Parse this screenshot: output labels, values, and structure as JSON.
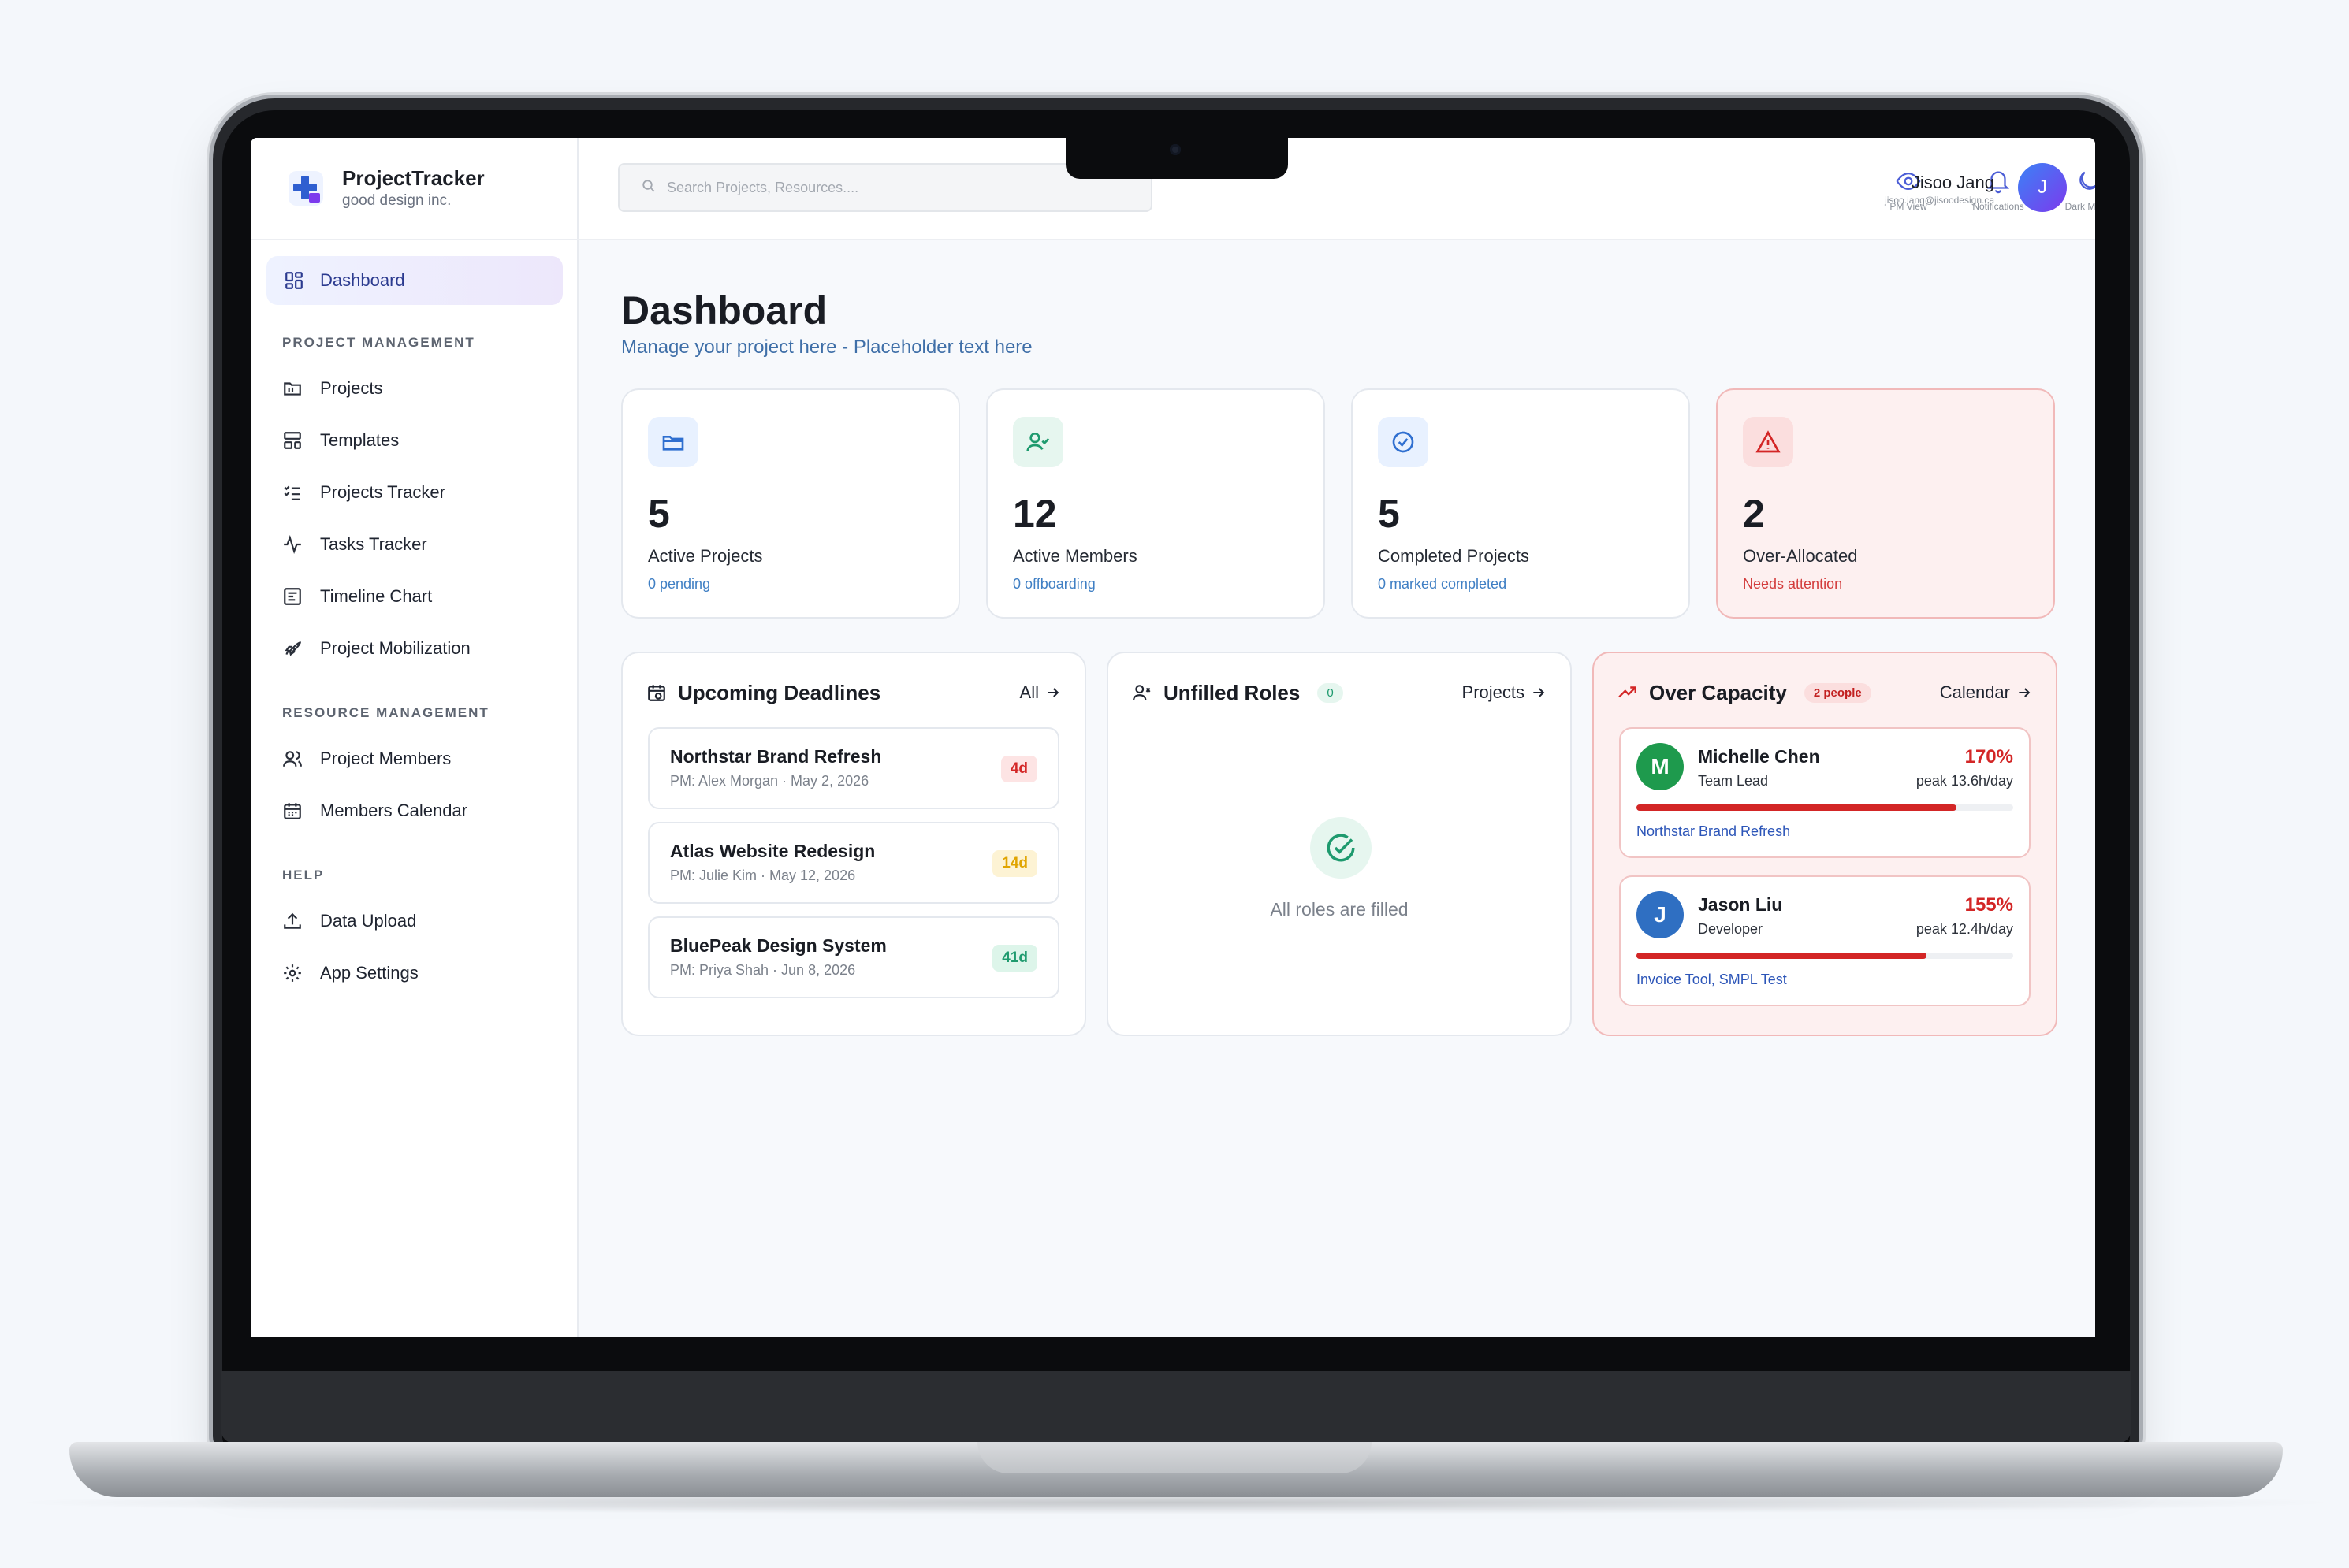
{
  "app": {
    "name": "ProjectTracker",
    "org": "good design inc."
  },
  "sidebar": {
    "active": {
      "label": "Dashboard",
      "icon": "dashboard-grid-icon"
    },
    "sections": [
      {
        "title": "PROJECT MANAGEMENT",
        "items": [
          {
            "label": "Projects",
            "icon": "folder-icon"
          },
          {
            "label": "Templates",
            "icon": "template-icon"
          },
          {
            "label": "Projects Tracker",
            "icon": "checklist-icon"
          },
          {
            "label": "Tasks Tracker",
            "icon": "activity-icon"
          },
          {
            "label": "Timeline Chart",
            "icon": "timeline-icon"
          },
          {
            "label": "Project Mobilization",
            "icon": "rocket-icon"
          }
        ]
      },
      {
        "title": "RESOURCE MANAGEMENT",
        "items": [
          {
            "label": "Project Members",
            "icon": "users-icon"
          },
          {
            "label": "Members Calendar",
            "icon": "calendar-icon"
          }
        ]
      },
      {
        "title": "HELP",
        "items": [
          {
            "label": "Data Upload",
            "icon": "upload-icon"
          },
          {
            "label": "App Settings",
            "icon": "gear-icon"
          }
        ]
      }
    ]
  },
  "topbar": {
    "search_placeholder": "Search Projects, Resources....",
    "actions": [
      {
        "label": "PM View",
        "icon": "eye-icon"
      },
      {
        "label": "Notifications",
        "icon": "bell-icon"
      },
      {
        "label": "Dark Mode",
        "icon": "moon-icon"
      }
    ],
    "user": {
      "name": "Jisoo Jang",
      "email": "jisoo.jang@jisoodesign.ca",
      "initial": "J"
    }
  },
  "page": {
    "title": "Dashboard",
    "subtitle": "Manage your project here - Placeholder text here"
  },
  "stats": [
    {
      "value": "5",
      "label": "Active Projects",
      "note": "0 pending",
      "icon": "folder-open-icon"
    },
    {
      "value": "12",
      "label": "Active Members",
      "note": "0 offboarding",
      "icon": "user-check-icon"
    },
    {
      "value": "5",
      "label": "Completed Projects",
      "note": "0 marked completed",
      "icon": "check-circle-icon"
    },
    {
      "value": "2",
      "label": "Over-Allocated",
      "note": "Needs attention",
      "icon": "warning-icon"
    }
  ],
  "deadlines": {
    "title": "Upcoming Deadlines",
    "link": "All",
    "items": [
      {
        "name": "Northstar Brand Refresh",
        "meta": "PM: Alex Morgan · May 2, 2026",
        "badge": "4d"
      },
      {
        "name": "Atlas Website Redesign",
        "meta": "PM: Julie Kim · May 12, 2026",
        "badge": "14d"
      },
      {
        "name": "BluePeak Design System",
        "meta": "PM: Priya Shah · Jun 8, 2026",
        "badge": "41d"
      }
    ]
  },
  "roles": {
    "title": "Unfilled Roles",
    "count": "0",
    "link": "Projects",
    "empty": "All roles are filled"
  },
  "capacity": {
    "title": "Over Capacity",
    "count": "2 people",
    "link": "Calendar",
    "people": [
      {
        "initial": "M",
        "name": "Michelle Chen",
        "role": "Team Lead",
        "pct": "170%",
        "peak": "peak 13.6h/day",
        "projects": "Northstar Brand Refresh",
        "bar_fill": 0.85,
        "color": "#1e9a4d"
      },
      {
        "initial": "J",
        "name": "Jason Liu",
        "role": "Developer",
        "pct": "155%",
        "peak": "peak 12.4h/day",
        "projects": "Invoice Tool, SMPL Test",
        "bar_fill": 0.77,
        "color": "#2f6fc2"
      }
    ]
  },
  "colors": {
    "accent": "#3b5bdb",
    "danger": "#d32626",
    "success": "#1e9a6e",
    "warning": "#e0a400"
  }
}
